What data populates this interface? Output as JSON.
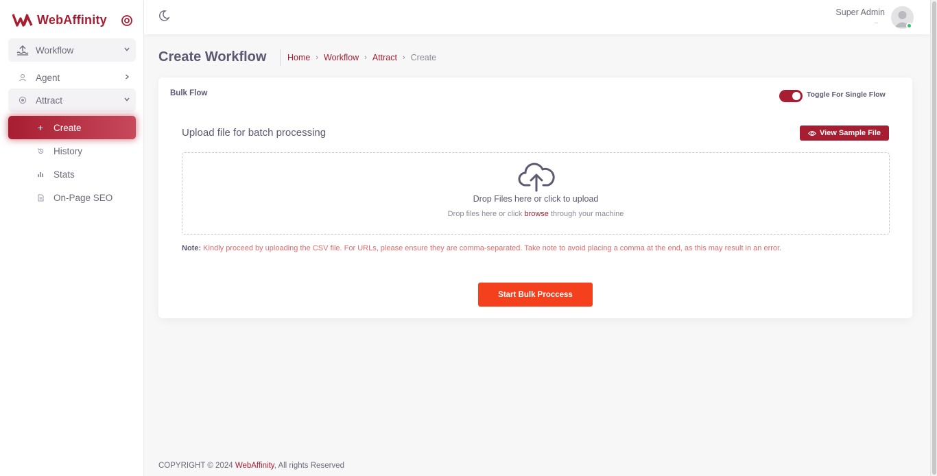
{
  "brand": {
    "name": "WebAffinity"
  },
  "sidebar": {
    "groups": [
      {
        "label": "Workflow",
        "icon": "workflow-icon"
      },
      {
        "label": "Agent",
        "icon": "person-icon"
      },
      {
        "label": "Attract",
        "icon": "target-icon"
      }
    ],
    "sub_items": [
      {
        "label": "Create",
        "icon": "plus-icon",
        "active": true
      },
      {
        "label": "History",
        "icon": "history-icon"
      },
      {
        "label": "Stats",
        "icon": "bar-chart-icon"
      },
      {
        "label": "On-Page SEO",
        "icon": "document-icon"
      }
    ]
  },
  "topbar": {
    "user_name": "Super Admin",
    "user_role": "–",
    "status_color": "#28c76f"
  },
  "page": {
    "title": "Create Workflow",
    "breadcrumbs": [
      "Home",
      "Workflow",
      "Attract",
      "Create"
    ]
  },
  "card": {
    "section_label": "Bulk Flow",
    "toggle_label": "Toggle For Single Flow",
    "toggle_on": true,
    "upload_heading": "Upload file for batch processing",
    "sample_button": "View Sample File",
    "drop_title": "Drop Files here or click to upload",
    "drop_sub_before": "Drop files here or click ",
    "drop_sub_link": "browse",
    "drop_sub_after": " through your machine",
    "note_label": "Note:",
    "note_text": "Kindly proceed by uploading the CSV file. For URLs, please ensure they are comma-separated. Take note to avoid placing a comma at the end, as this may result in an error.",
    "start_button": "Start Bulk Proccess"
  },
  "footer": {
    "prefix": "COPYRIGHT © 2024 ",
    "brand": "WebAffinity",
    "suffix": ", All rights Reserved"
  },
  "colors": {
    "brand": "#a71d31",
    "accent_button": "#f5401e"
  }
}
